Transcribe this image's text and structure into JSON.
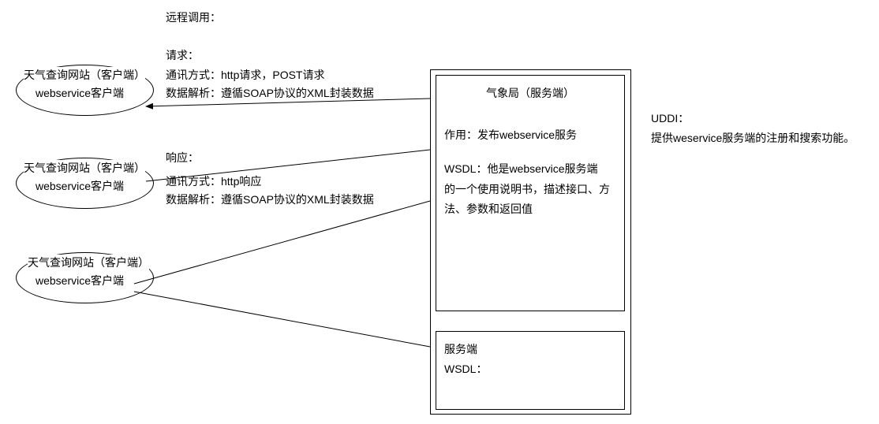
{
  "header": {
    "title": "远程调用："
  },
  "request_section": {
    "label": "请求：",
    "comm_method": "通讯方式：http请求，POST请求",
    "data_parse": "数据解析：遵循SOAP协议的XML封装数据"
  },
  "response_section": {
    "label": "响应：",
    "comm_method": "通讯方式：http响应",
    "data_parse": "数据解析：遵循SOAP协议的XML封装数据"
  },
  "clients": [
    {
      "line1": "天气查询网站（客户端）",
      "line2": "webservice客户端"
    },
    {
      "line1": "天气查询网站（客户端）",
      "line2": "webservice客户端"
    },
    {
      "line1": "天气查询网站（客户端）",
      "line2": "webservice客户端"
    }
  ],
  "server_box": {
    "title": "气象局（服务端）",
    "purpose": "作用：发布webservice服务",
    "wsdl_line1": "WSDL：他是webservice服务端",
    "wsdl_line2": "的一个使用说明书，描述接口、方",
    "wsdl_line3": "法、参数和返回值"
  },
  "sub_box": {
    "line1": "服务端",
    "line2": "WSDL："
  },
  "uddi": {
    "label": "UDDI：",
    "desc": "提供weservice服务端的注册和搜索功能。"
  }
}
